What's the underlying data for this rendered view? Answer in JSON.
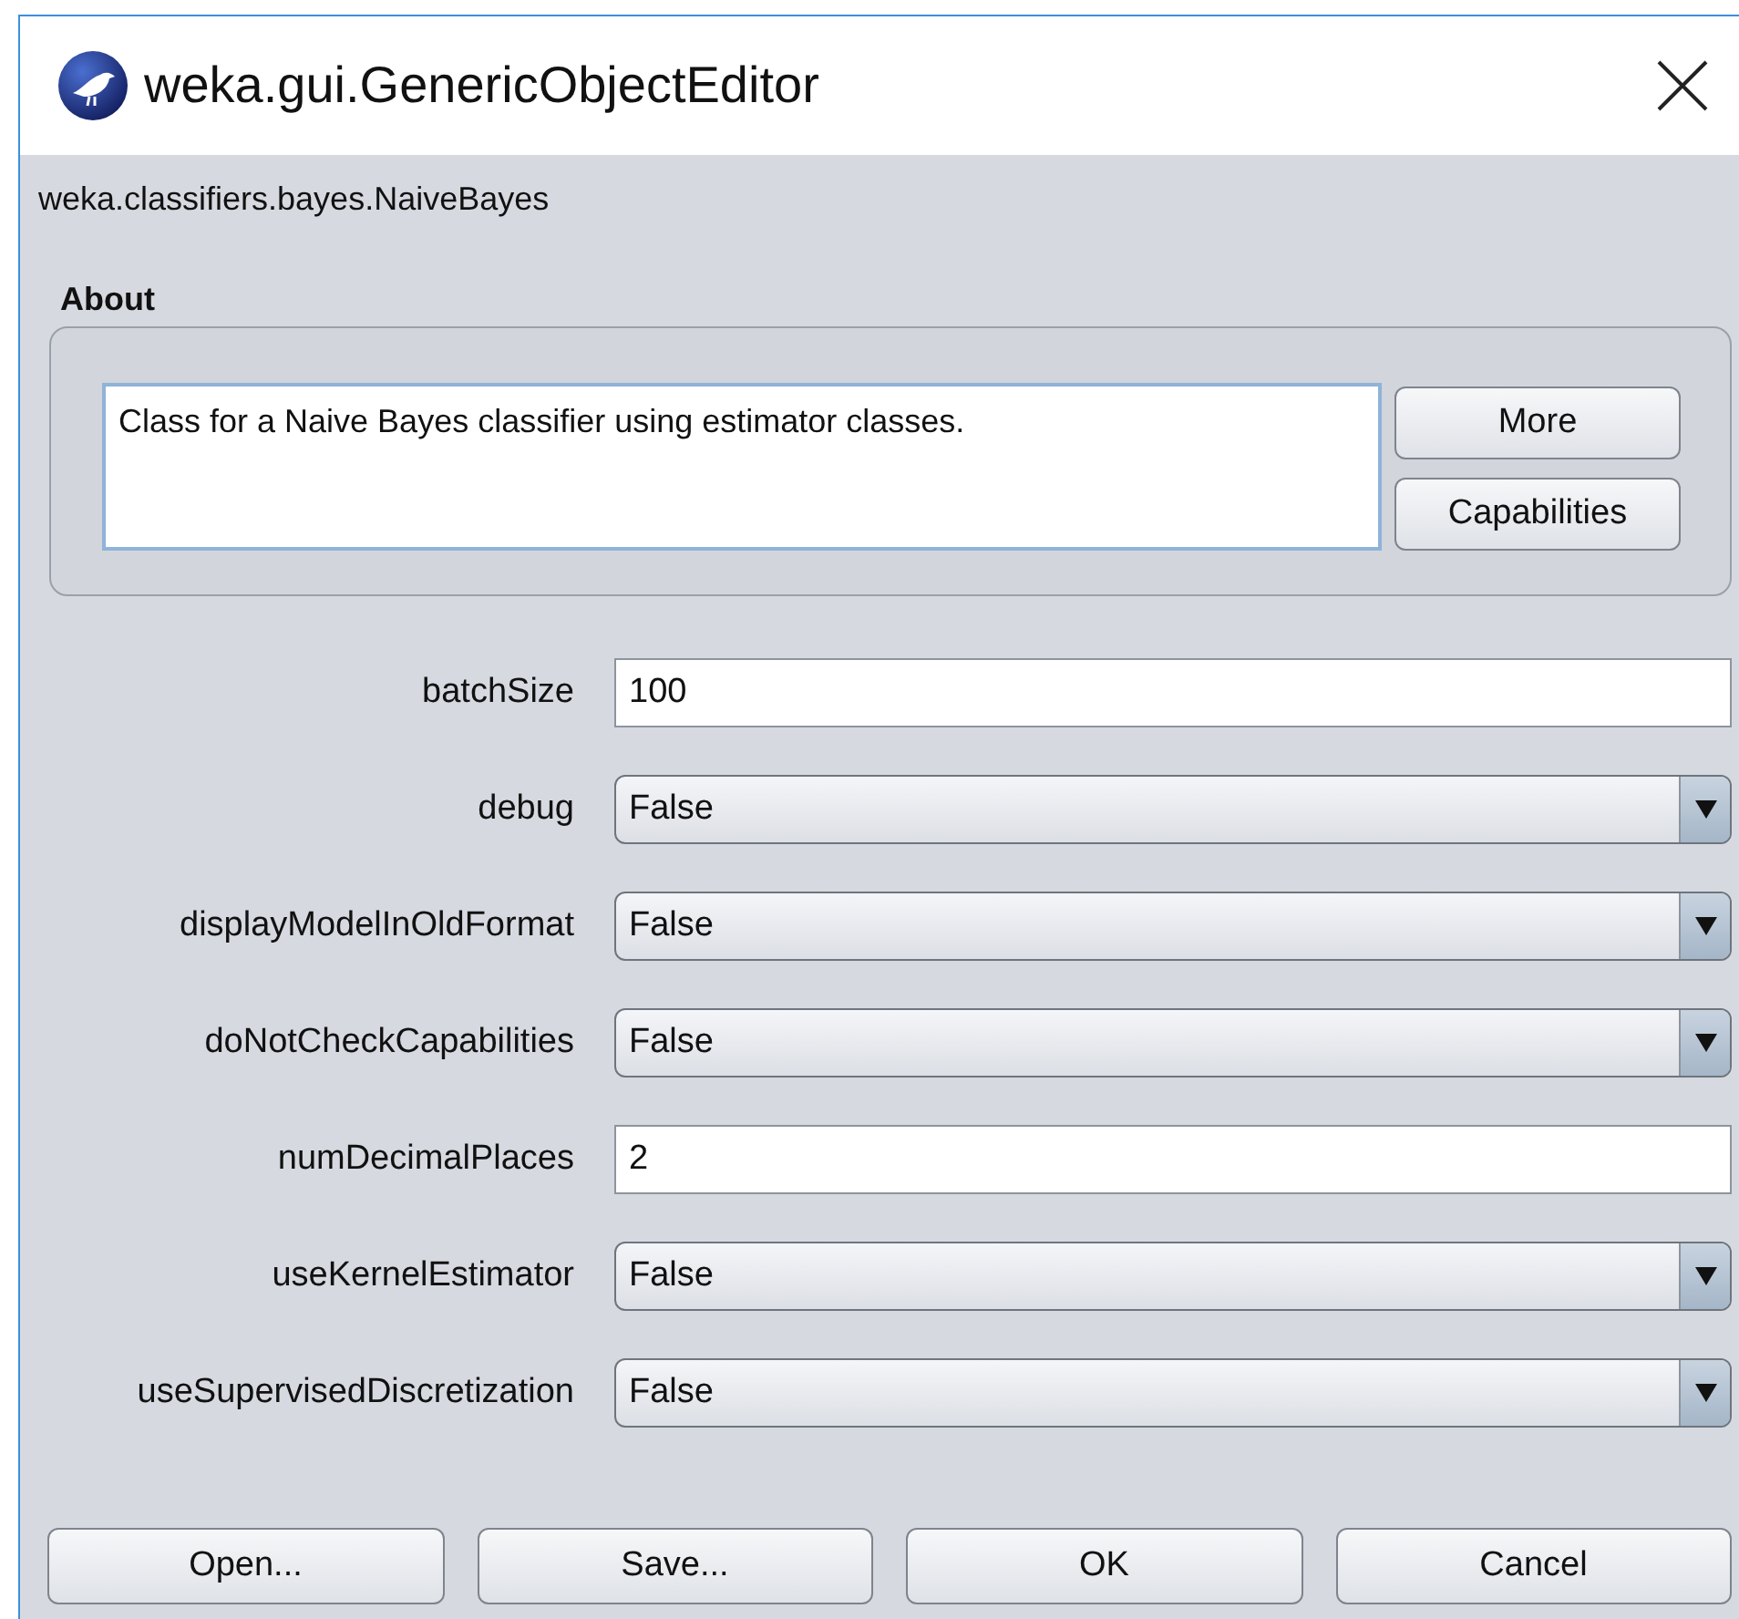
{
  "window": {
    "title": "weka.gui.GenericObjectEditor"
  },
  "class_name": "weka.classifiers.bayes.NaiveBayes",
  "about": {
    "heading": "About",
    "text": "Class for a Naive Bayes classifier using estimator classes.",
    "buttons": [
      "More",
      "Capabilities"
    ]
  },
  "properties": [
    {
      "label": "batchSize",
      "kind": "text",
      "value": "100"
    },
    {
      "label": "debug",
      "kind": "choice",
      "value": "False"
    },
    {
      "label": "displayModelInOldFormat",
      "kind": "choice",
      "value": "False"
    },
    {
      "label": "doNotCheckCapabilities",
      "kind": "choice",
      "value": "False"
    },
    {
      "label": "numDecimalPlaces",
      "kind": "text",
      "value": "2"
    },
    {
      "label": "useKernelEstimator",
      "kind": "choice",
      "value": "False"
    },
    {
      "label": "useSupervisedDiscretization",
      "kind": "choice",
      "value": "False"
    }
  ],
  "buttons": [
    "Open...",
    "Save...",
    "OK",
    "Cancel"
  ]
}
